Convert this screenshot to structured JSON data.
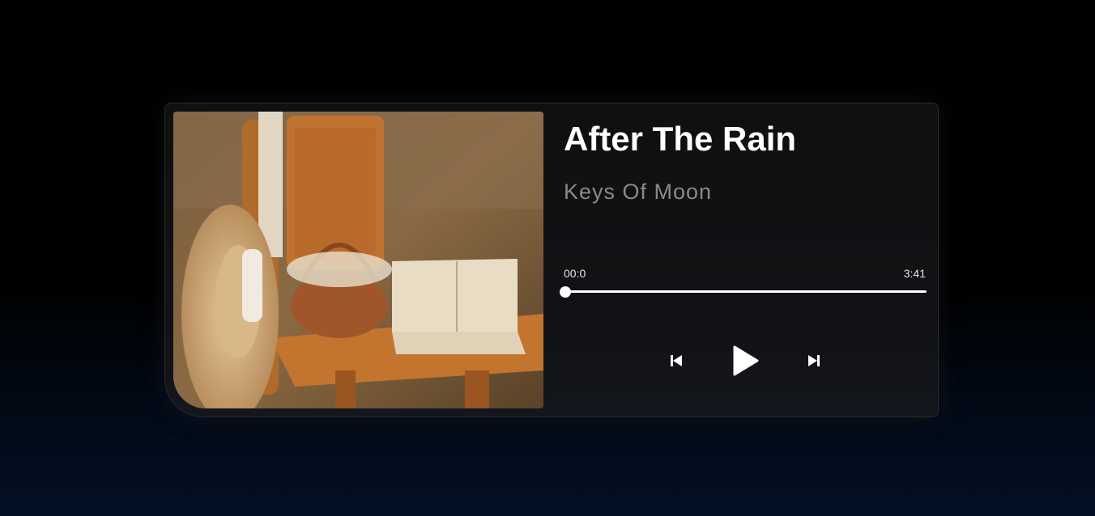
{
  "track": {
    "title": "After The Rain",
    "artist": "Keys Of Moon",
    "cover_alt": "album-cover"
  },
  "progress": {
    "current": "00:0",
    "total": "3:41",
    "fraction": 0
  },
  "controls": {
    "prev_icon": "skip-previous-icon",
    "play_icon": "play-icon",
    "next_icon": "skip-next-icon"
  },
  "colors": {
    "background": "#000000",
    "card": "#101010",
    "title": "#ffffff",
    "artist": "#8a8a8a",
    "accent": "#ffffff"
  }
}
